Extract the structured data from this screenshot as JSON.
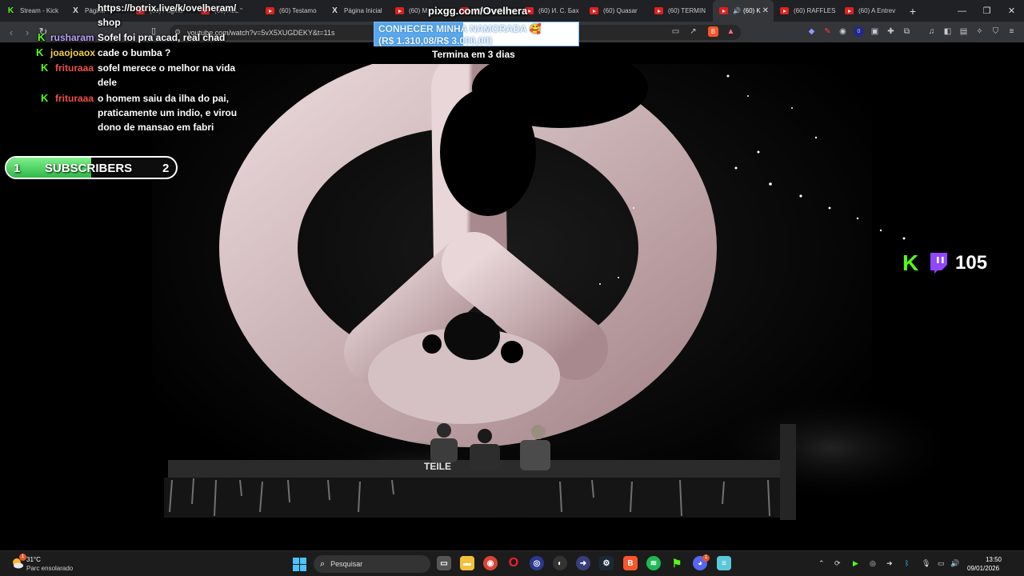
{
  "browser": {
    "tabs": [
      {
        "icon": "kick-icon",
        "label": "Stream - Kick"
      },
      {
        "icon": "x-icon",
        "label": "Página"
      },
      {
        "icon": "youtube-icon",
        "label": "(60) Pagina"
      },
      {
        "icon": "youtube-icon",
        "label": "(60) ALL \""
      },
      {
        "icon": "youtube-icon",
        "label": "(60) Testamo"
      },
      {
        "icon": "x-icon",
        "label": "Página Inicial"
      },
      {
        "icon": "youtube-icon",
        "label": "(60) M"
      },
      {
        "icon": "youtube-icon",
        "label": "(60) Ovelhera"
      },
      {
        "icon": "youtube-icon",
        "label": "(60) И. С. Бах"
      },
      {
        "icon": "youtube-icon",
        "label": "(60) Quasar"
      },
      {
        "icon": "youtube-icon",
        "label": "(60) TERMIN"
      },
      {
        "icon": "youtube-icon",
        "label": "(60) K"
      },
      {
        "icon": "youtube-icon",
        "label": "(60) RAFFLES"
      },
      {
        "icon": "youtube-icon",
        "label": "(60) A Entrev"
      }
    ],
    "active_tab_index": 11,
    "url": "youtube.com/watch?v=5vX5XUGDEKY&t=11s"
  },
  "overlay": {
    "botrix_link": "https://botrix.live/k/ovelheram/",
    "shop_label": "shop",
    "chat": [
      {
        "user": "rusharam",
        "color": "#b9a1f5",
        "text": "Sofel foi pra acad, real chad"
      },
      {
        "user": "joaojoaox",
        "color": "#f2d14a",
        "text": "cade o bumba ?"
      },
      {
        "user": "frituraaa",
        "color": "#f0504a",
        "text": "sofel merece o melhor na vida dele"
      },
      {
        "user": "frituraaa",
        "color": "#f0504a",
        "text": "o homem saiu da ilha do pai, praticamente um indio, e virou dono de mansao em fabri"
      }
    ],
    "subscribers": {
      "label": "SUBSCRIBERS",
      "current": "1",
      "goal": "2",
      "progress": 0.5
    },
    "pix": {
      "site": "pixgg.com/Ovelhera",
      "goal_title": "CONHECER MINHA NAMORADA 🥰",
      "goal_amount": "(R$ 1.310,08/R$ 3.000,00)",
      "progress": 0.4367,
      "ends": "Termina em 3 dias"
    },
    "viewers": {
      "count": "105"
    }
  },
  "video": {
    "stage_text": "TEILE"
  },
  "taskbar": {
    "weather_temp": "31°C",
    "weather_desc": "Parc ensolarado",
    "weather_badge": "1",
    "search_placeholder": "Pesquisar",
    "discord_badge": "1",
    "time": "13:50",
    "date": "09/01/2026"
  },
  "colors": {
    "kick_green": "#53fc18",
    "twitch_purple": "#9146ff",
    "pix_blue": "#5aa8ec"
  }
}
